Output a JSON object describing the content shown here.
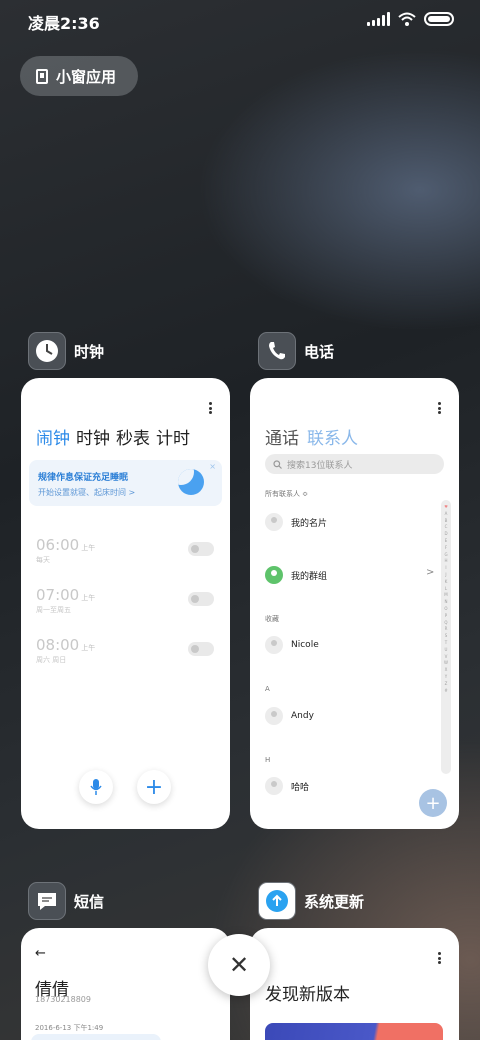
{
  "status_bar": {
    "time": "凌晨2:36"
  },
  "mini_window_button": {
    "label": "小窗应用"
  },
  "clock_app": {
    "name": "时钟",
    "tabs": [
      "闹钟",
      "时钟",
      "秒表",
      "计时"
    ],
    "banner": {
      "title": "规律作息保证充足睡眠",
      "subtitle": "开始设置就寝、起床时间 >",
      "close": "×"
    },
    "alarms": [
      {
        "time": "06:00",
        "ampm": "上午",
        "desc": "每天"
      },
      {
        "time": "07:00",
        "ampm": "上午",
        "desc": "周一至周五"
      },
      {
        "time": "08:00",
        "ampm": "上午",
        "desc": "周六 周日"
      }
    ],
    "add_symbol": "+"
  },
  "phone_app": {
    "name": "电话",
    "tabs": [
      "通话",
      "联系人"
    ],
    "search_placeholder": "搜索13位联系人",
    "all_contacts_label": "所有联系人 ≎",
    "my_card": "我的名片",
    "my_groups": "我的群组",
    "groups_chevron": ">",
    "sections": [
      {
        "header": "收藏",
        "contact": "Nicole"
      },
      {
        "header": "A",
        "contact": "Andy"
      },
      {
        "header": "H",
        "contact": "哈哈"
      }
    ],
    "alphabet": [
      "♥",
      "A",
      "B",
      "C",
      "D",
      "E",
      "F",
      "G",
      "H",
      "I",
      "J",
      "K",
      "L",
      "M",
      "N",
      "O",
      "P",
      "Q",
      "R",
      "S",
      "T",
      "U",
      "V",
      "W",
      "X",
      "Y",
      "Z",
      "#"
    ],
    "add_symbol": "+"
  },
  "sms_app": {
    "name": "短信",
    "back_arrow": "←",
    "contact_name": "倩倩",
    "contact_number": "18730218809",
    "date": "2016-6-13 下午1:49"
  },
  "update_app": {
    "name": "系统更新",
    "title": "发现新版本"
  },
  "close_all_symbol": "✕"
}
